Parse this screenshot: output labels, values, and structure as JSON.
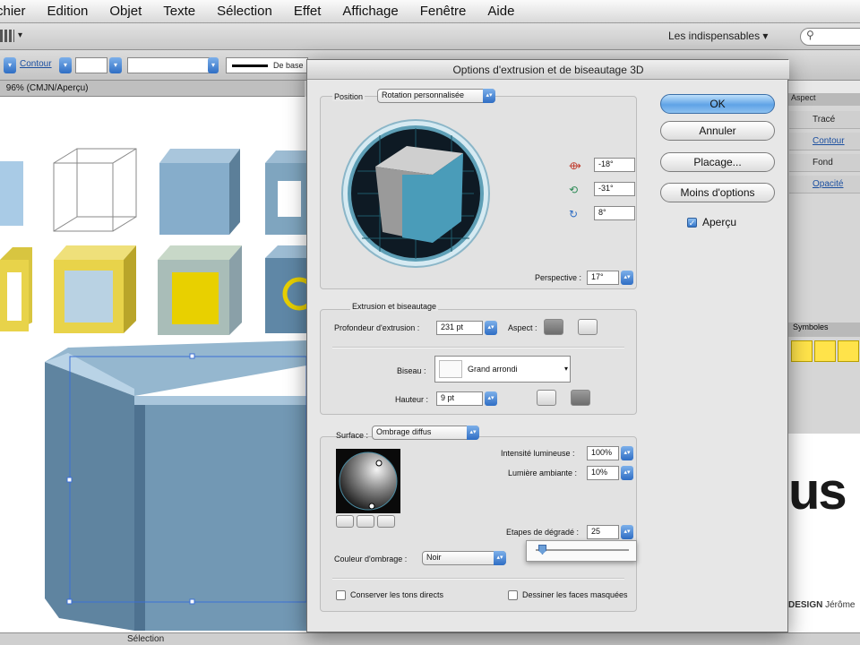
{
  "menubar": {
    "items": [
      "chier",
      "Edition",
      "Objet",
      "Texte",
      "Sélection",
      "Effet",
      "Affichage",
      "Fenêtre",
      "Aide"
    ]
  },
  "appbar": {
    "workspace_label": "Les indispensables ▾",
    "search_placeholder": ""
  },
  "controlbar": {
    "contour_label": "Contour",
    "stroke_label": "De base"
  },
  "document": {
    "tab_label": " 96% (CMJN/Aperçu)"
  },
  "statusbar": {
    "tool_label": "Sélection"
  },
  "right_panel": {
    "header": "Aspect",
    "trace_label": "Tracé",
    "contour_label": "Contour",
    "fond_label": "Fond",
    "opacite_label": "Opacité",
    "symbols_header": "Symboles"
  },
  "canvas_text": {
    "big_text": "us",
    "footer_bold": "DESIGN",
    "footer_rest": " Jérôme"
  },
  "dialog": {
    "title": "Options d'extrusion et de biseautage 3D",
    "buttons": {
      "ok": "OK",
      "cancel": "Annuler",
      "map": "Placage...",
      "less": "Moins d'options"
    },
    "preview_label": "Aperçu",
    "position": {
      "label": "Position",
      "preset": "Rotation personnalisée",
      "x_rotation": "-18°",
      "y_rotation": "-31°",
      "z_rotation": "8°",
      "perspective_label": "Perspective :",
      "perspective_value": "17°"
    },
    "extrusion": {
      "label": "Extrusion et biseautage",
      "depth_label": "Profondeur d'extrusion :",
      "depth_value": "231 pt",
      "cap_label": "Aspect :",
      "bevel_label": "Biseau :",
      "bevel_value": "Grand arrondi",
      "height_label": "Hauteur :",
      "height_value": "9 pt"
    },
    "surface": {
      "label": "Surface :",
      "value": "Ombrage diffus",
      "intensity_label": "Intensité lumineuse :",
      "intensity_value": "100%",
      "ambient_label": "Lumière ambiante :",
      "ambient_value": "10%",
      "steps_label": "Etapes de dégradé :",
      "steps_value": "25",
      "shading_color_label": "Couleur d'ombrage :",
      "shading_color_value": "Noir",
      "preserve_spot_label": "Conserver les tons directs",
      "draw_hidden_label": "Dessiner les faces masquées"
    }
  },
  "colors": {
    "cube_blue": "#7fa5bf",
    "cube_yellow": "#e8d34a",
    "accent_blue": "#3476c9"
  }
}
